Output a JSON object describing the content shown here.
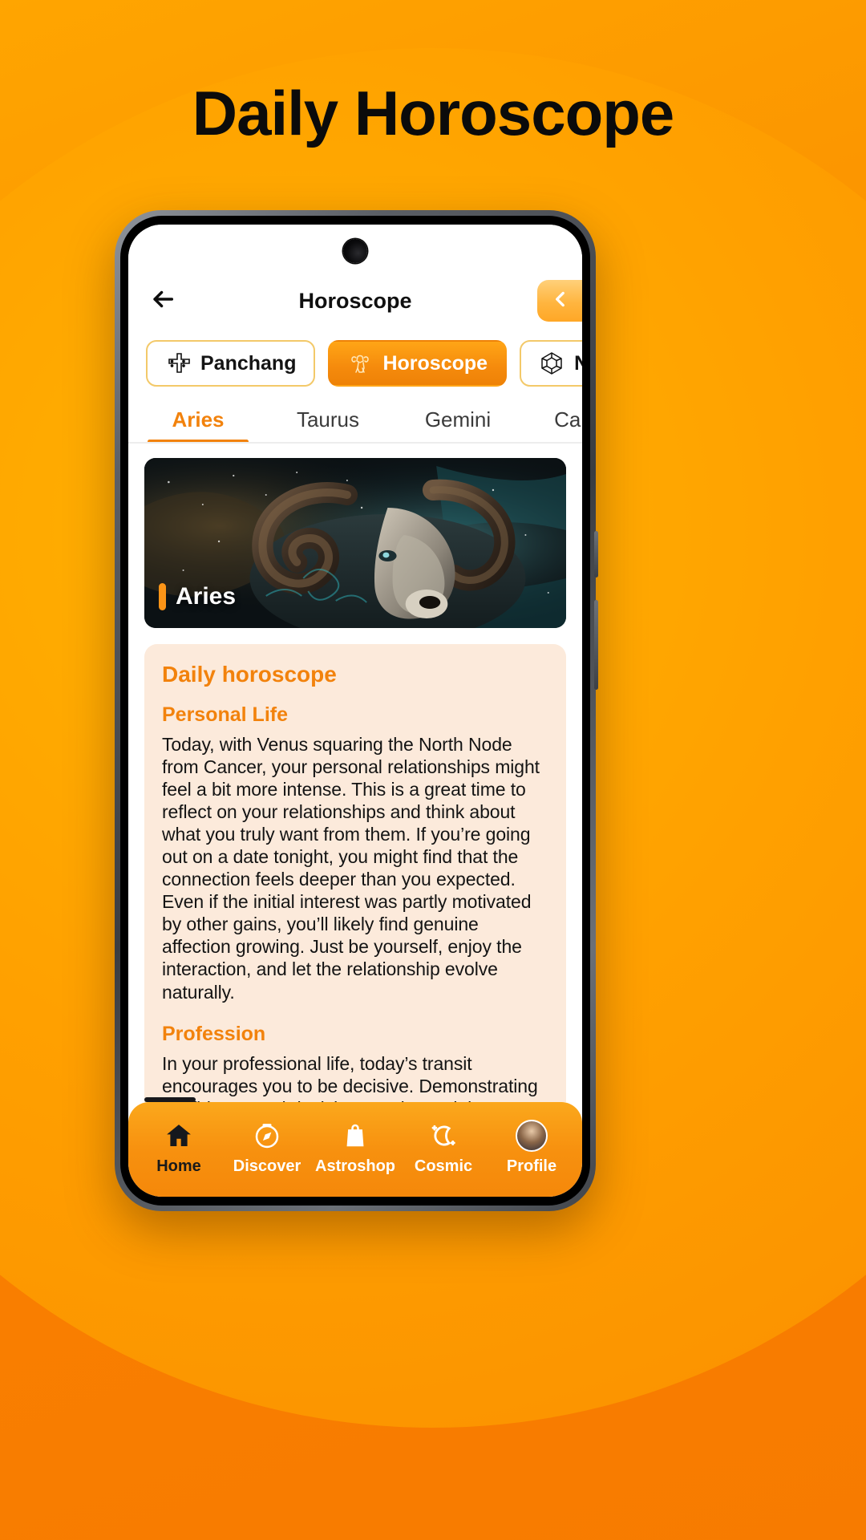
{
  "promo": {
    "title": "Daily Horoscope",
    "bg_color": "#FFA000",
    "title_color": "#0B0B0B"
  },
  "app": {
    "header": {
      "back_icon": "arrow-left-icon",
      "title": "Horoscope",
      "language_icon": "chevron-left-icon"
    },
    "category_pills": [
      {
        "label": "Panchang",
        "icon": "swastika-icon",
        "active": false
      },
      {
        "label": "Horoscope",
        "icon": "aries-ram-icon",
        "active": true
      },
      {
        "label": "Numerology",
        "icon": "numerology-dice-icon",
        "active": false
      }
    ],
    "zodiac_tabs": [
      {
        "label": "Aries",
        "active": true
      },
      {
        "label": "Taurus",
        "active": false
      },
      {
        "label": "Gemini",
        "active": false
      },
      {
        "label": "Cancer",
        "active": false
      }
    ],
    "hero": {
      "sign_name": "Aries",
      "accent_color": "#FB9417"
    },
    "horoscope_card": {
      "title": "Daily horoscope",
      "accent_color": "#F2820C",
      "background_color": "#FCEADB",
      "sections": [
        {
          "heading": "Personal Life",
          "body": "Today, with Venus squaring the North Node from Cancer, your personal relationships might feel a bit more intense. This is a great time to reflect on your relationships and think about what you truly want from them. If you’re going out on a date tonight, you might find that the connection feels deeper than you expected. Even if the initial interest was partly motivated by other gains, you’ll likely find genuine affection growing. Just be yourself, enjoy the interaction, and let the relationship evolve naturally."
        },
        {
          "heading": "Profession",
          "body": "In your professional life, today’s transit encourages you to be decisive. Demonstrating confidence and decisiveness is crucial, as"
        }
      ]
    },
    "bottom_nav": [
      {
        "label": "Home",
        "icon": "home-icon",
        "active": true
      },
      {
        "label": "Discover",
        "icon": "compass-icon",
        "active": false
      },
      {
        "label": "Astroshop",
        "icon": "shopping-bag-icon",
        "active": false
      },
      {
        "label": "Cosmic",
        "icon": "moon-stars-icon",
        "active": false
      },
      {
        "label": "Profile",
        "icon": "avatar-icon",
        "active": false
      }
    ]
  }
}
